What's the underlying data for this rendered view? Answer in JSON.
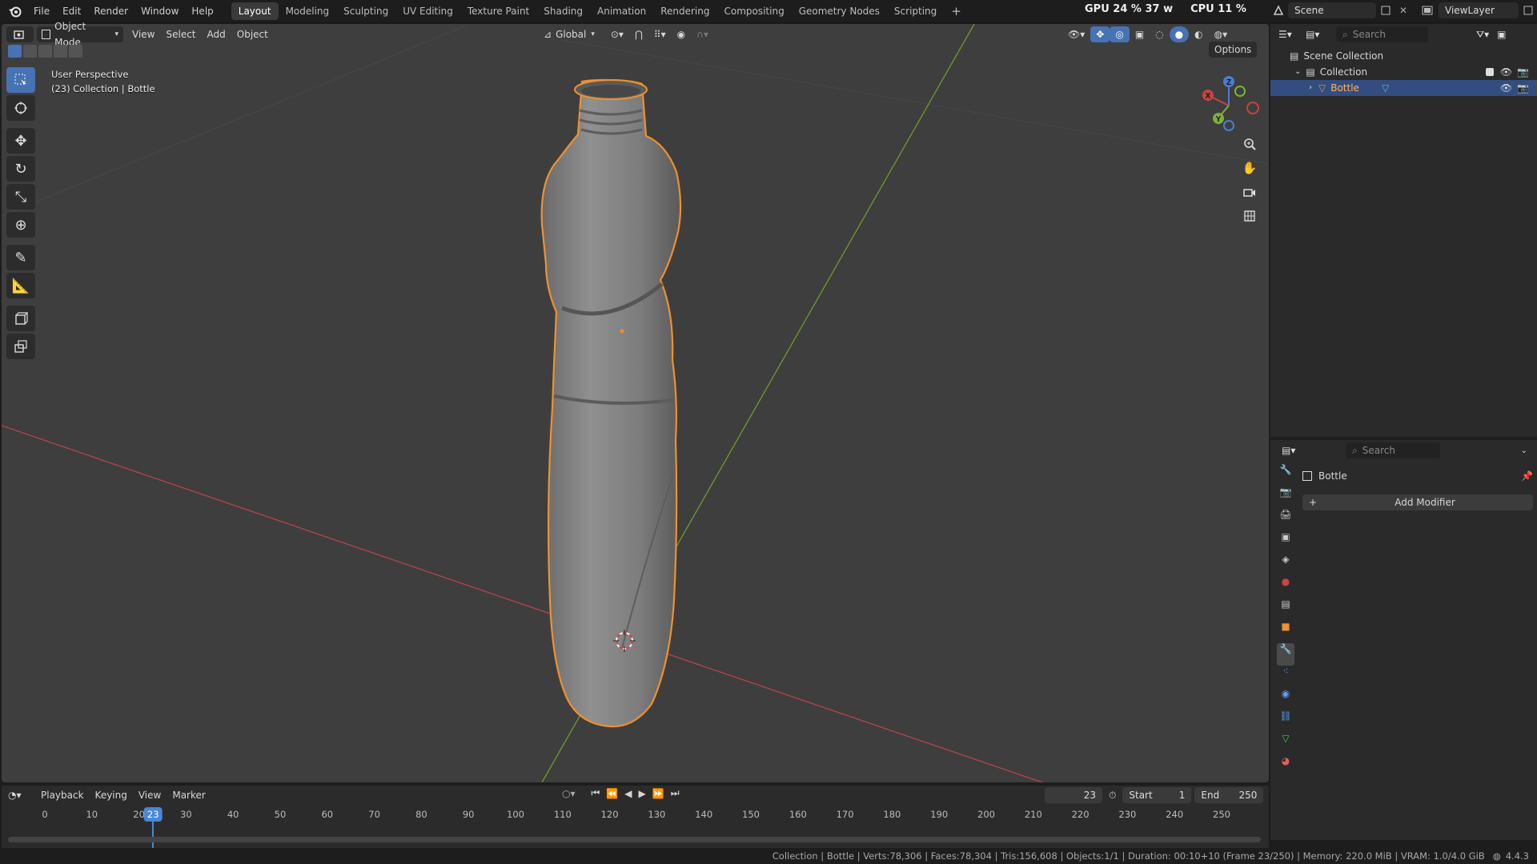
{
  "menubar": {
    "menus": [
      "File",
      "Edit",
      "Render",
      "Window",
      "Help"
    ],
    "workspaces": [
      "Layout",
      "Modeling",
      "Sculpting",
      "UV Editing",
      "Texture Paint",
      "Shading",
      "Animation",
      "Rendering",
      "Compositing",
      "Geometry Nodes",
      "Scripting"
    ],
    "active_workspace": "Layout",
    "add_tab": "+",
    "gpu_stat": "GPU 24 % 37 w",
    "cpu_stat": "CPU 11 %",
    "scene_name": "Scene",
    "view_layer": "ViewLayer"
  },
  "viewport": {
    "mode": "Object Mode",
    "menus": [
      "View",
      "Select",
      "Add",
      "Object"
    ],
    "orientation": "Global",
    "options_label": "Options",
    "overlay_title": "User Perspective",
    "overlay_subtitle": "(23) Collection | Bottle",
    "gizmo": {
      "x": "X",
      "y": "Y",
      "z": "Z"
    },
    "colors": {
      "background": "#3e3e3e",
      "x_axis": "#b3464c",
      "y_axis": "#6f9a2c",
      "selection": "#f0902f"
    }
  },
  "outliner": {
    "search_placeholder": "Search",
    "scene_collection": "Scene Collection",
    "collection": "Collection",
    "object": "Bottle"
  },
  "properties": {
    "search_placeholder": "Search",
    "object_name": "Bottle",
    "add_modifier": "Add Modifier"
  },
  "timeline": {
    "menus": [
      "Playback",
      "Keying",
      "View",
      "Marker"
    ],
    "current_frame": "23",
    "start_label": "Start",
    "start_value": "1",
    "end_label": "End",
    "end_value": "250",
    "ruler": [
      "0",
      "10",
      "20",
      "30",
      "40",
      "50",
      "60",
      "70",
      "80",
      "90",
      "100",
      "110",
      "120",
      "130",
      "140",
      "150",
      "160",
      "170",
      "180",
      "190",
      "200",
      "210",
      "220",
      "230",
      "240",
      "250"
    ],
    "playhead": "23"
  },
  "statusbar": {
    "text": "Collection | Bottle | Verts:78,306 | Faces:78,304 | Tris:156,608 | Objects:1/1 | Duration: 00:10+10 (Frame 23/250) | Memory: 220.0 MiB | VRAM: 1.0/4.0 GiB",
    "version": "4.4.3"
  }
}
